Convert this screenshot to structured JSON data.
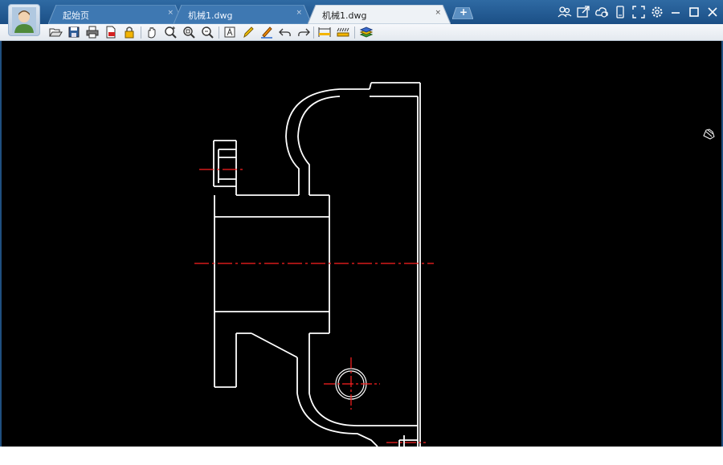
{
  "tabs": [
    {
      "label": "起始页",
      "close": "×"
    },
    {
      "label": "机械1.dwg",
      "close": "×"
    },
    {
      "label": "机械1.dwg",
      "close": "×",
      "active": true
    }
  ],
  "new_tab": "+",
  "toolbar": {
    "icons": [
      "open-icon",
      "save-icon",
      "print-icon",
      "pdf-export-icon",
      "lock-icon",
      "pan-icon",
      "zoom-icon",
      "zoom-window-icon",
      "zoom-realtime-icon",
      "text-icon",
      "pencil-icon",
      "markup-pen-icon",
      "undo-icon",
      "redo-icon",
      "measure-icon",
      "dimension-icon",
      "layers-icon"
    ]
  },
  "window_controls": [
    "users-icon",
    "share-icon",
    "cloud-icon",
    "mobile-icon",
    "fullscreen-icon",
    "settings-icon",
    "minimize-icon",
    "maximize-icon",
    "close-icon"
  ],
  "colors": {
    "canvas": "#000000",
    "drawing_line": "#ffffff",
    "center_line": "#ff2020",
    "titlebar": "#1b4f86",
    "toolbar": "#eef2f6"
  }
}
